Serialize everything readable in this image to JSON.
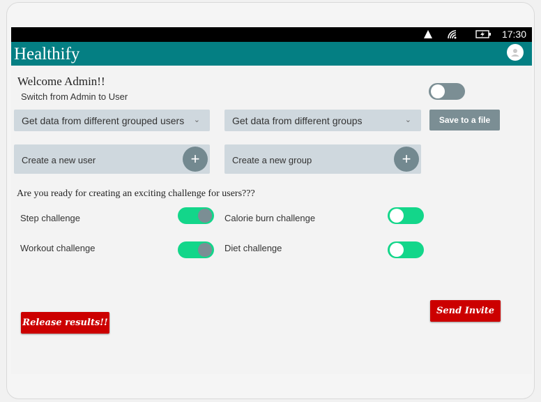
{
  "status_bar": {
    "time": "17:30"
  },
  "app": {
    "title": "Healthify"
  },
  "admin": {
    "welcome": "Welcome Admin!!",
    "switch_text": "Switch from Admin to User"
  },
  "dropdowns": {
    "grouped_users": "Get data from different grouped users",
    "groups": "Get data from different groups"
  },
  "save_button": "Save to a file",
  "create": {
    "user": "Create a new user",
    "group": "Create a new group",
    "plus": "+"
  },
  "challenge": {
    "question": "Are you ready for creating an exciting challenge for users???",
    "items": [
      {
        "label": "Step challenge",
        "state": "on"
      },
      {
        "label": "Calorie burn challenge",
        "state": "off"
      },
      {
        "label": "Workout challenge",
        "state": "on"
      },
      {
        "label": "Diet challenge",
        "state": "off"
      }
    ]
  },
  "buttons": {
    "release": "Release results!!",
    "invite": "Send Invite"
  },
  "colors": {
    "appbar": "#047f83",
    "toggle_active": "#13d68a",
    "toggle_grey": "#7b8e94",
    "action_red": "#cc0000",
    "field_bg": "#cfd8de"
  },
  "icons": [
    "signal-icon",
    "wifi-icon",
    "battery-charging-icon",
    "avatar-icon",
    "chevron-down-icon",
    "plus-icon"
  ]
}
